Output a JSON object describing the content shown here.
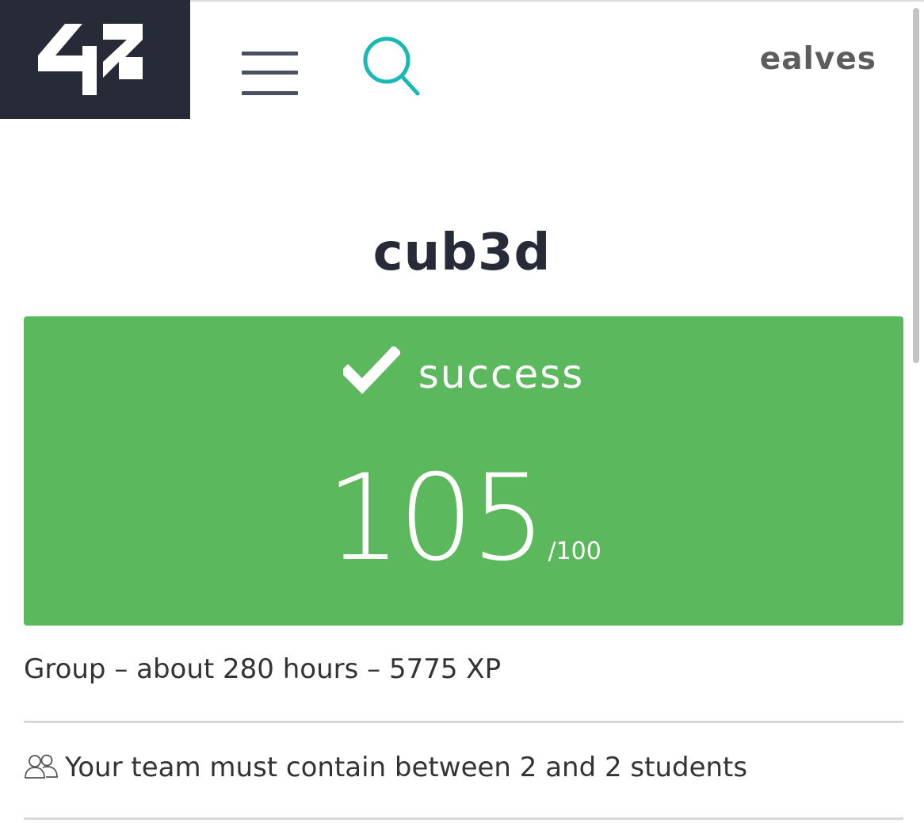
{
  "header": {
    "logo_text": "42",
    "menu_icon": "hamburger-menu-icon",
    "search_icon": "search-icon",
    "username": "ealves",
    "accent_color": "#18b8b5",
    "background_dark": "#272b38"
  },
  "project": {
    "title": "cub3d",
    "status_icon": "checkmark-icon",
    "status": "success",
    "score": "105",
    "score_max": "/100",
    "status_color": "#5cb85c",
    "meta": "Group – about 280 hours – 5775 XP",
    "team_icon": "group-users-icon",
    "team_rule": "Your team must contain between 2 and 2 students"
  }
}
